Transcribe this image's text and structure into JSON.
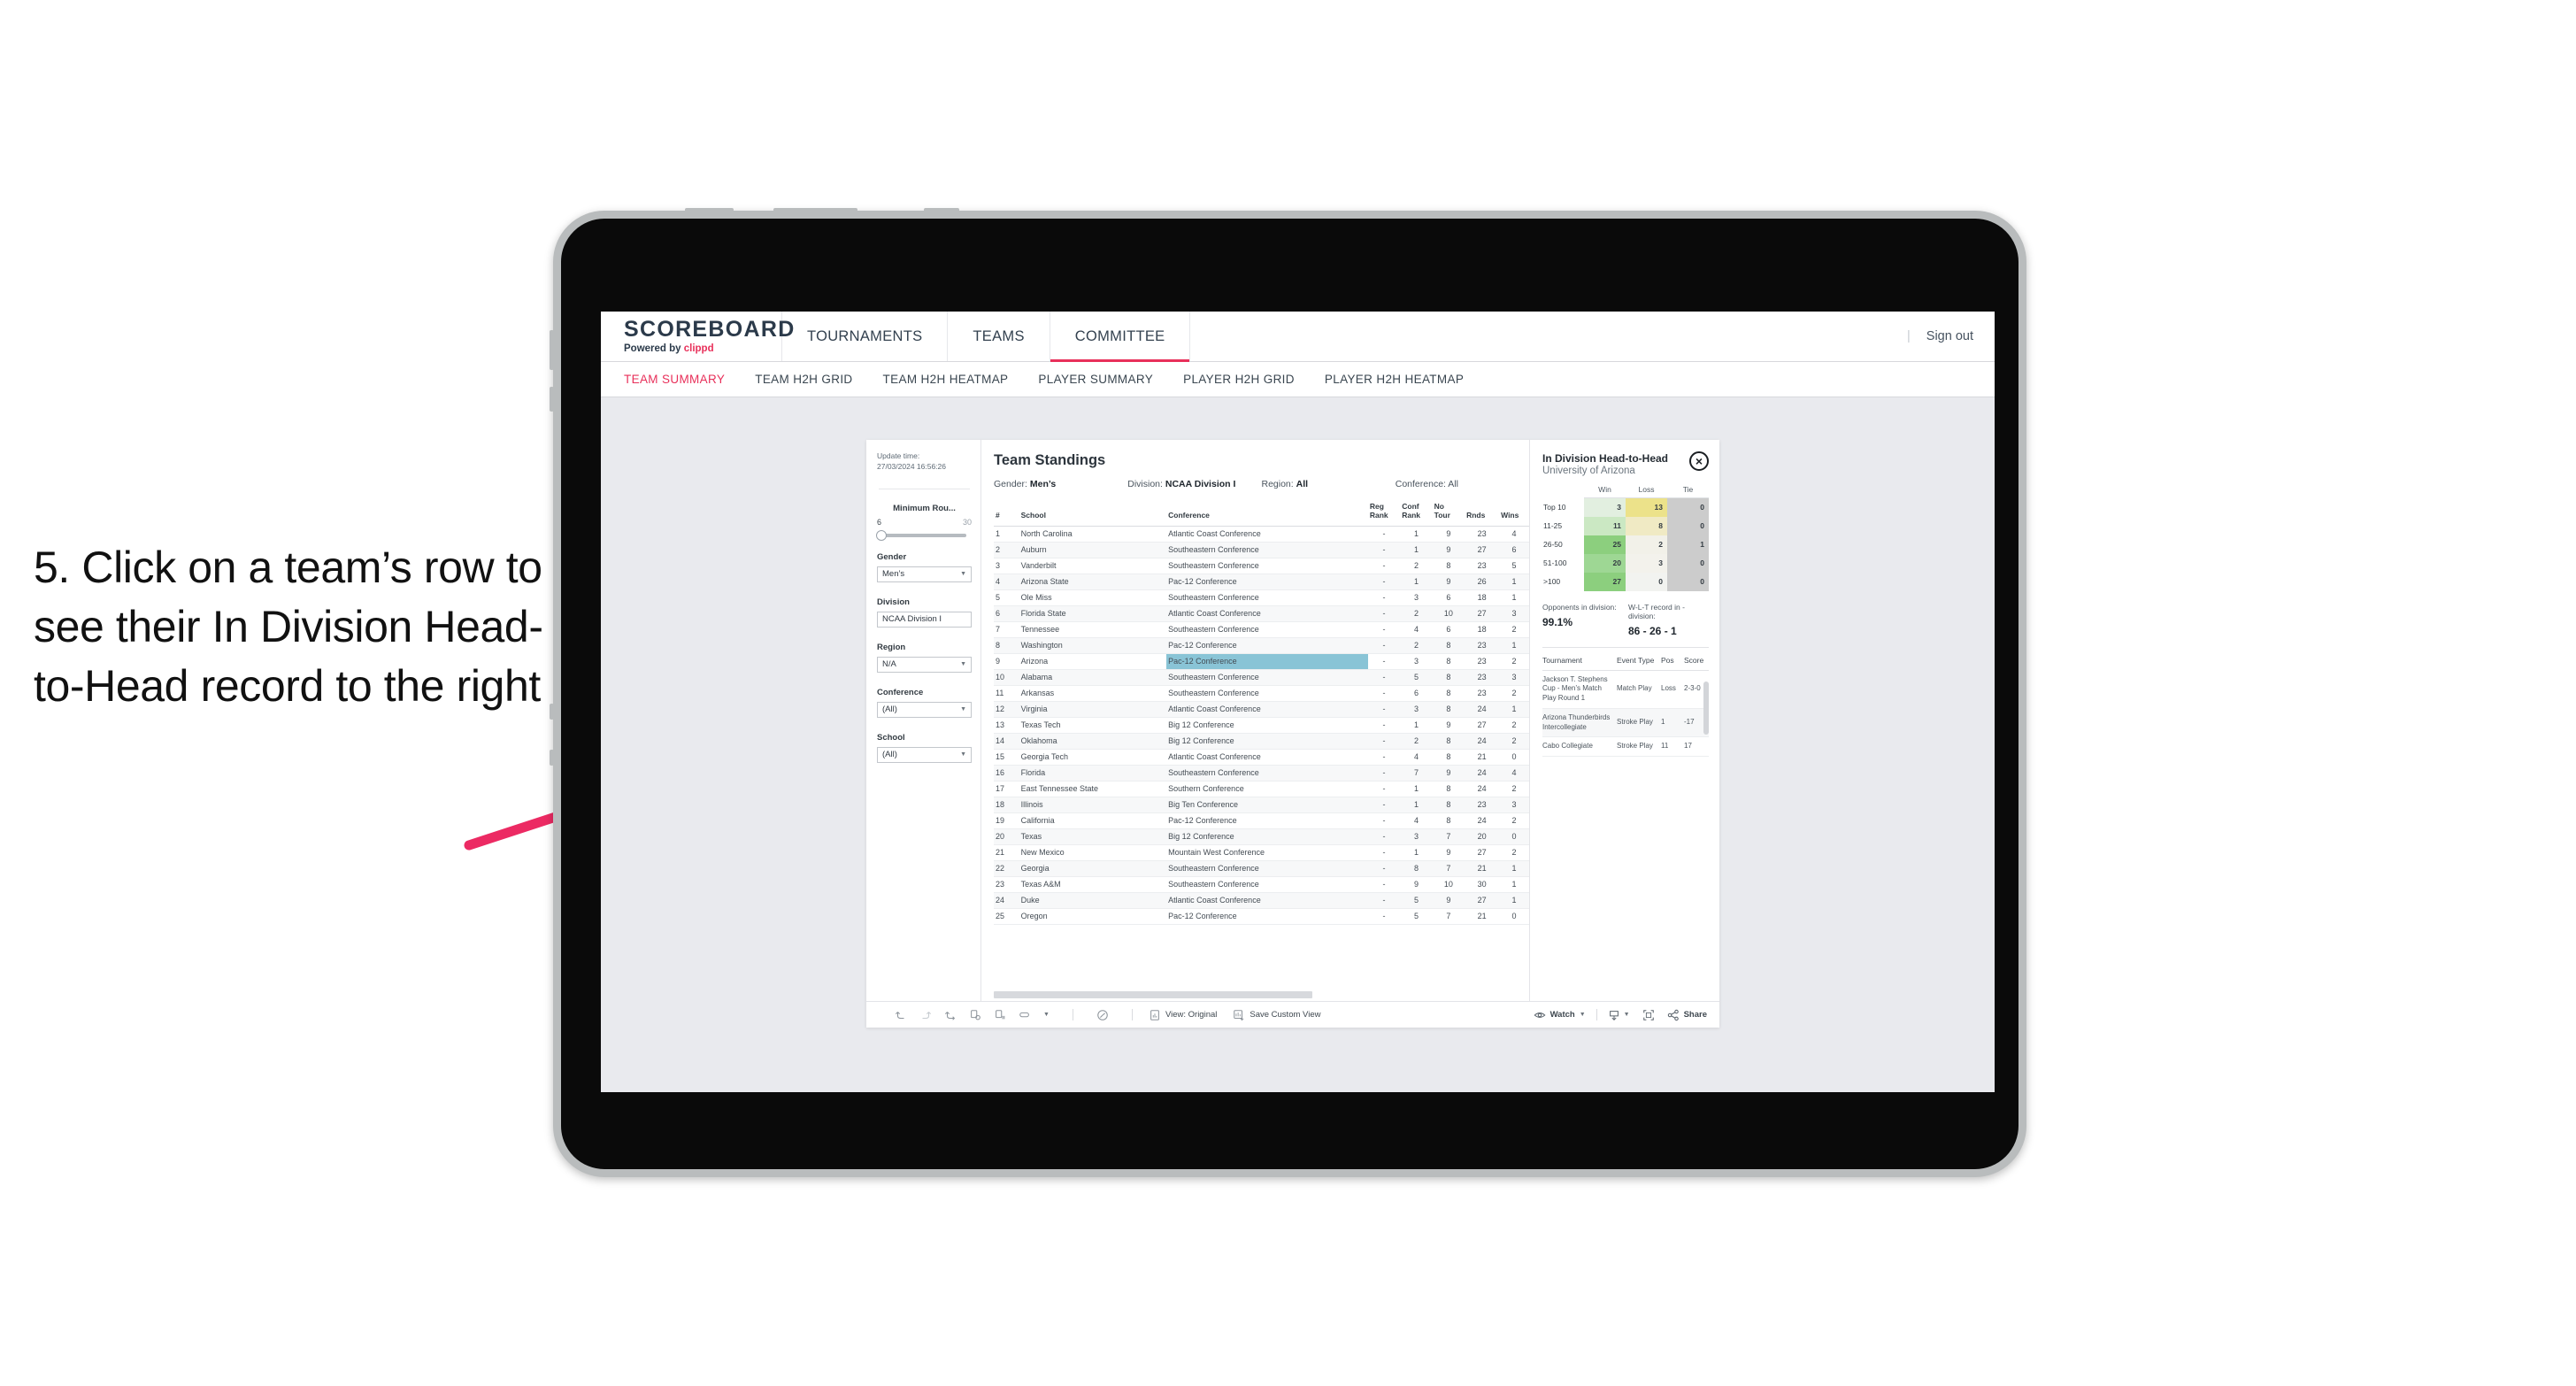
{
  "instruction": "5. Click on a team’s row to see their In Division Head-to-Head record to the right",
  "colors": {
    "accent_pink": "#e8305a",
    "highlight_row": "#89c4d6",
    "green_strong": "#8ccf7e",
    "yellow": "#ece28a",
    "grey_tie": "#cccccc"
  },
  "topnav": {
    "logo_title": "SCOREBOARD",
    "logo_sub_prefix": "Powered by ",
    "logo_sub_brand": "clippd",
    "items": [
      {
        "label": "TOURNAMENTS",
        "active": false
      },
      {
        "label": "TEAMS",
        "active": false
      },
      {
        "label": "COMMITTEE",
        "active": true
      }
    ],
    "divider": "|",
    "signout": "Sign out"
  },
  "subnav": {
    "items": [
      {
        "label": "TEAM SUMMARY",
        "active": true
      },
      {
        "label": "TEAM H2H GRID",
        "active": false
      },
      {
        "label": "TEAM H2H HEATMAP",
        "active": false
      },
      {
        "label": "PLAYER SUMMARY",
        "active": false
      },
      {
        "label": "PLAYER H2H GRID",
        "active": false
      },
      {
        "label": "PLAYER H2H HEATMAP",
        "active": false
      }
    ]
  },
  "sidebar": {
    "update_label": "Update time:",
    "update_value": "27/03/2024 16:56:26",
    "slider": {
      "title": "Minimum Rou...",
      "min": "6",
      "max": "30"
    },
    "filters": [
      {
        "title": "Gender",
        "value": "Men’s"
      },
      {
        "title": "Division",
        "value": "NCAA Division I"
      },
      {
        "title": "Region",
        "value": "N/A"
      },
      {
        "title": "Conference",
        "value": "(All)"
      },
      {
        "title": "School",
        "value": "(All)"
      }
    ]
  },
  "standings": {
    "title": "Team Standings",
    "meta": [
      {
        "label": "Gender:",
        "value": "Men’s"
      },
      {
        "label": "Division:",
        "value": "NCAA Division I"
      },
      {
        "label": "Region:",
        "value": "All"
      },
      {
        "label": "Conference:",
        "value": "All"
      }
    ],
    "columns": [
      "#",
      "School",
      "Conference",
      "Reg Rank",
      "Conf Rank",
      "No Tour",
      "Rnds",
      "Wins"
    ],
    "columns_display": [
      {
        "l1": "#",
        "l2": ""
      },
      {
        "l1": "School",
        "l2": ""
      },
      {
        "l1": "Conference",
        "l2": ""
      },
      {
        "l1": "Reg",
        "l2": "Rank"
      },
      {
        "l1": "Conf",
        "l2": "Rank"
      },
      {
        "l1": "No",
        "l2": "Tour"
      },
      {
        "l1": "Rnds",
        "l2": ""
      },
      {
        "l1": "Wins",
        "l2": ""
      }
    ],
    "rows": [
      {
        "n": "1",
        "school": "North Carolina",
        "conf": "Atlantic Coast Conference",
        "reg": "-",
        "confrank": "1",
        "notour": "9",
        "rnds": "23",
        "wins": "4",
        "hl": false
      },
      {
        "n": "2",
        "school": "Auburn",
        "conf": "Southeastern Conference",
        "reg": "-",
        "confrank": "1",
        "notour": "9",
        "rnds": "27",
        "wins": "6",
        "hl": false
      },
      {
        "n": "3",
        "school": "Vanderbilt",
        "conf": "Southeastern Conference",
        "reg": "-",
        "confrank": "2",
        "notour": "8",
        "rnds": "23",
        "wins": "5",
        "hl": false
      },
      {
        "n": "4",
        "school": "Arizona State",
        "conf": "Pac-12 Conference",
        "reg": "-",
        "confrank": "1",
        "notour": "9",
        "rnds": "26",
        "wins": "1",
        "hl": false
      },
      {
        "n": "5",
        "school": "Ole Miss",
        "conf": "Southeastern Conference",
        "reg": "-",
        "confrank": "3",
        "notour": "6",
        "rnds": "18",
        "wins": "1",
        "hl": false
      },
      {
        "n": "6",
        "school": "Florida State",
        "conf": "Atlantic Coast Conference",
        "reg": "-",
        "confrank": "2",
        "notour": "10",
        "rnds": "27",
        "wins": "3",
        "hl": false
      },
      {
        "n": "7",
        "school": "Tennessee",
        "conf": "Southeastern Conference",
        "reg": "-",
        "confrank": "4",
        "notour": "6",
        "rnds": "18",
        "wins": "2",
        "hl": false
      },
      {
        "n": "8",
        "school": "Washington",
        "conf": "Pac-12 Conference",
        "reg": "-",
        "confrank": "2",
        "notour": "8",
        "rnds": "23",
        "wins": "1",
        "hl": false
      },
      {
        "n": "9",
        "school": "Arizona",
        "conf": "Pac-12 Conference",
        "reg": "-",
        "confrank": "3",
        "notour": "8",
        "rnds": "23",
        "wins": "2",
        "hl": true
      },
      {
        "n": "10",
        "school": "Alabama",
        "conf": "Southeastern Conference",
        "reg": "-",
        "confrank": "5",
        "notour": "8",
        "rnds": "23",
        "wins": "3",
        "hl": false
      },
      {
        "n": "11",
        "school": "Arkansas",
        "conf": "Southeastern Conference",
        "reg": "-",
        "confrank": "6",
        "notour": "8",
        "rnds": "23",
        "wins": "2",
        "hl": false
      },
      {
        "n": "12",
        "school": "Virginia",
        "conf": "Atlantic Coast Conference",
        "reg": "-",
        "confrank": "3",
        "notour": "8",
        "rnds": "24",
        "wins": "1",
        "hl": false
      },
      {
        "n": "13",
        "school": "Texas Tech",
        "conf": "Big 12 Conference",
        "reg": "-",
        "confrank": "1",
        "notour": "9",
        "rnds": "27",
        "wins": "2",
        "hl": false
      },
      {
        "n": "14",
        "school": "Oklahoma",
        "conf": "Big 12 Conference",
        "reg": "-",
        "confrank": "2",
        "notour": "8",
        "rnds": "24",
        "wins": "2",
        "hl": false
      },
      {
        "n": "15",
        "school": "Georgia Tech",
        "conf": "Atlantic Coast Conference",
        "reg": "-",
        "confrank": "4",
        "notour": "8",
        "rnds": "21",
        "wins": "0",
        "hl": false
      },
      {
        "n": "16",
        "school": "Florida",
        "conf": "Southeastern Conference",
        "reg": "-",
        "confrank": "7",
        "notour": "9",
        "rnds": "24",
        "wins": "4",
        "hl": false
      },
      {
        "n": "17",
        "school": "East Tennessee State",
        "conf": "Southern Conference",
        "reg": "-",
        "confrank": "1",
        "notour": "8",
        "rnds": "24",
        "wins": "2",
        "hl": false
      },
      {
        "n": "18",
        "school": "Illinois",
        "conf": "Big Ten Conference",
        "reg": "-",
        "confrank": "1",
        "notour": "8",
        "rnds": "23",
        "wins": "3",
        "hl": false
      },
      {
        "n": "19",
        "school": "California",
        "conf": "Pac-12 Conference",
        "reg": "-",
        "confrank": "4",
        "notour": "8",
        "rnds": "24",
        "wins": "2",
        "hl": false
      },
      {
        "n": "20",
        "school": "Texas",
        "conf": "Big 12 Conference",
        "reg": "-",
        "confrank": "3",
        "notour": "7",
        "rnds": "20",
        "wins": "0",
        "hl": false
      },
      {
        "n": "21",
        "school": "New Mexico",
        "conf": "Mountain West Conference",
        "reg": "-",
        "confrank": "1",
        "notour": "9",
        "rnds": "27",
        "wins": "2",
        "hl": false
      },
      {
        "n": "22",
        "school": "Georgia",
        "conf": "Southeastern Conference",
        "reg": "-",
        "confrank": "8",
        "notour": "7",
        "rnds": "21",
        "wins": "1",
        "hl": false
      },
      {
        "n": "23",
        "school": "Texas A&M",
        "conf": "Southeastern Conference",
        "reg": "-",
        "confrank": "9",
        "notour": "10",
        "rnds": "30",
        "wins": "1",
        "hl": false
      },
      {
        "n": "24",
        "school": "Duke",
        "conf": "Atlantic Coast Conference",
        "reg": "-",
        "confrank": "5",
        "notour": "9",
        "rnds": "27",
        "wins": "1",
        "hl": false
      },
      {
        "n": "25",
        "school": "Oregon",
        "conf": "Pac-12 Conference",
        "reg": "-",
        "confrank": "5",
        "notour": "7",
        "rnds": "21",
        "wins": "0",
        "hl": false
      }
    ]
  },
  "h2h": {
    "title": "In Division Head-to-Head",
    "subtitle": "University of Arizona",
    "close_label": "×",
    "columns": [
      "",
      "Win",
      "Loss",
      "Tie"
    ],
    "rows": [
      {
        "label": "Top 10",
        "win": "3",
        "loss": "13",
        "tie": "0",
        "win_color": "#e2efe0",
        "loss_color": "#ece28a",
        "tie_color": "#cccccc"
      },
      {
        "label": "11-25",
        "win": "11",
        "loss": "8",
        "tie": "0",
        "win_color": "#cbe8c3",
        "loss_color": "#f0eac4",
        "tie_color": "#cccccc"
      },
      {
        "label": "26-50",
        "win": "25",
        "loss": "2",
        "tie": "1",
        "win_color": "#8ccf7e",
        "loss_color": "#f2f1e9",
        "tie_color": "#cccccc"
      },
      {
        "label": "51-100",
        "win": "20",
        "loss": "3",
        "tie": "0",
        "win_color": "#9ed794",
        "loss_color": "#f3f2ec",
        "tie_color": "#cccccc"
      },
      {
        "label": ">100",
        "win": "27",
        "loss": "0",
        "tie": "0",
        "win_color": "#8ccf7e",
        "loss_color": "#f2f3f0",
        "tie_color": "#cccccc"
      }
    ],
    "stats": [
      {
        "label": "Opponents in division:",
        "value": "99.1%"
      },
      {
        "label": "W-L-T record in -division:",
        "value": "86 - 26 - 1"
      }
    ],
    "tournament_columns": [
      "Tournament",
      "Event Type",
      "Pos",
      "Score"
    ],
    "tournaments": [
      {
        "name": "Jackson T. Stephens Cup - Men’s Match Play Round 1",
        "type": "Match Play",
        "pos": "Loss",
        "score": "2-3-0"
      },
      {
        "name": "Arizona Thunderbirds Intercollegiate",
        "type": "Stroke Play",
        "pos": "1",
        "score": "-17"
      },
      {
        "name": "Cabo Collegiate",
        "type": "Stroke Play",
        "pos": "11",
        "score": "17"
      }
    ]
  },
  "toolbar": {
    "view_label": "View: Original",
    "save_label": "Save Custom View",
    "watch_label": "Watch",
    "share_label": "Share",
    "caret": "▾"
  }
}
